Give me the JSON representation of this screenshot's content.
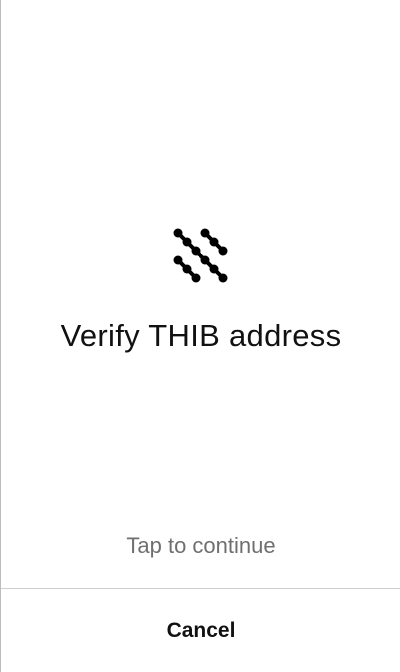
{
  "screen": {
    "icon": "thib-dots-logo-icon",
    "title": "Verify THIB address",
    "hint": "Tap to continue",
    "cancel_label": "Cancel"
  },
  "colors": {
    "background": "#ffffff",
    "text": "#111111",
    "hint": "#6f6f6f",
    "divider": "#cfcfcf"
  }
}
